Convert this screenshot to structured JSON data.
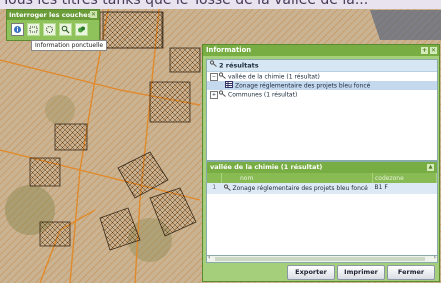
{
  "banner_text": "Tous les titres tanks que le Tosse de la vallée de la...",
  "tool_panel": {
    "title": "Interroger les couches",
    "close_glyph": "✕",
    "tooltip": "Information ponctuelle"
  },
  "info_window": {
    "title": "Information",
    "results_header": "2 résultats",
    "tree": [
      {
        "label": "vallée de la chimie (1 résultat)",
        "toggle": "−"
      },
      {
        "label": "Zonage réglementaire des projets bleu foncé",
        "selected": true
      },
      {
        "label": "Communes (1 résultat)",
        "toggle": "+"
      }
    ],
    "detail": {
      "header": "vallée de la chimie (1 résultat)",
      "columns": [
        "nom",
        "codezone"
      ],
      "rows": [
        {
          "index": "1",
          "nom": "Zonage réglementaire des projets bleu foncé",
          "codezone": "B1 F"
        }
      ]
    },
    "buttons": {
      "export": "Exporter",
      "print": "Imprimer",
      "close": "Fermer"
    },
    "scroll_left": "‹",
    "scroll_right": "›"
  },
  "colors": {
    "panel_green": "#78ad44",
    "parcel_orange": "#e08a2c",
    "selection_blue": "#c5d9ee"
  },
  "icons": [
    "info-icon",
    "rectangle-select-icon",
    "circle-select-icon",
    "zoom-icon",
    "layers-icon",
    "key-icon",
    "table-icon"
  ]
}
